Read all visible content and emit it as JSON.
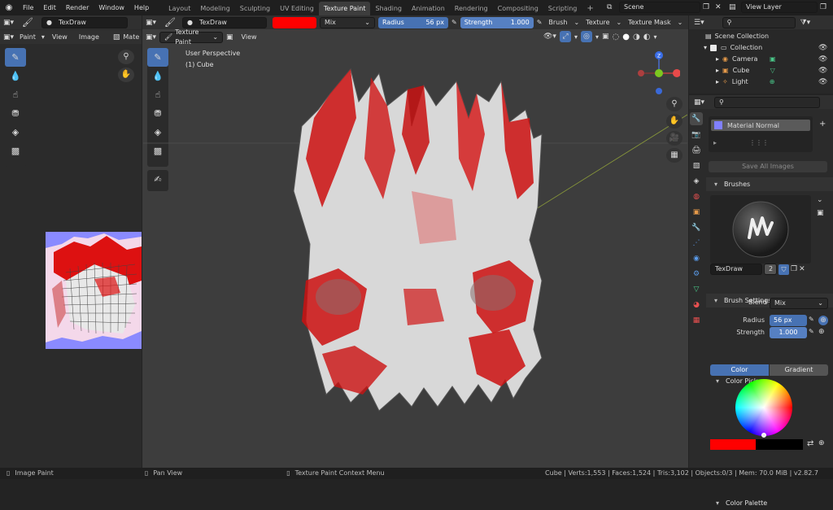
{
  "menubar": {
    "items": [
      "File",
      "Edit",
      "Render",
      "Window",
      "Help"
    ],
    "workspaces": [
      "Layout",
      "Modeling",
      "Sculpting",
      "UV Editing",
      "Texture Paint",
      "Shading",
      "Animation",
      "Rendering",
      "Compositing",
      "Scripting"
    ],
    "active_workspace": "Texture Paint",
    "add_tab": "+",
    "scene": "Scene",
    "view_layer": "View Layer"
  },
  "image_editor": {
    "brush_name": "TexDraw",
    "menus": [
      "Paint",
      "View",
      "Image"
    ],
    "mat_label": "Mate"
  },
  "viewport": {
    "brush_name": "TexDraw",
    "blend_mode": "Mix",
    "radius_label": "Radius",
    "radius_value": "56 px",
    "strength_label": "Strength",
    "strength_value": "1.000",
    "brush_menu": "Brush",
    "texture_menu": "Texture",
    "texture_mask_menu": "Texture Mask",
    "mode": "Texture Paint",
    "view_menu": "View",
    "overlay_perspective": "User Perspective",
    "overlay_object": "(1) Cube",
    "gizmo_z": "Z",
    "brush_color": "#ff0000"
  },
  "outliner": {
    "scene_collection": "Scene Collection",
    "collection": "Collection",
    "objects": [
      "Camera",
      "Cube",
      "Light"
    ]
  },
  "properties": {
    "material_slot": "Material Normal",
    "save_all_images": "Save All Images",
    "brushes_header": "Brushes",
    "brush_name": "TexDraw",
    "brush_users": "2",
    "brush_settings_header": "Brush Settings",
    "blend_label": "Blend",
    "blend_value": "Mix",
    "radius_label": "Radius",
    "radius_value": "56 px",
    "strength_label": "Strength",
    "strength_value": "1.000",
    "color_picker_header": "Color Picker",
    "color_tab": "Color",
    "gradient_tab": "Gradient",
    "color_palette_header": "Color Palette",
    "primary_color": "#ff0000",
    "secondary_color": "#000000"
  },
  "statusbar": {
    "left_action": "Image Paint",
    "middle_action": "Pan View",
    "right_action": "Texture Paint Context Menu",
    "stats": "Cube | Verts:1,553 | Faces:1,524 | Tris:3,102 | Objects:0/3 | Mem: 70.0 MiB | v2.82.7"
  }
}
